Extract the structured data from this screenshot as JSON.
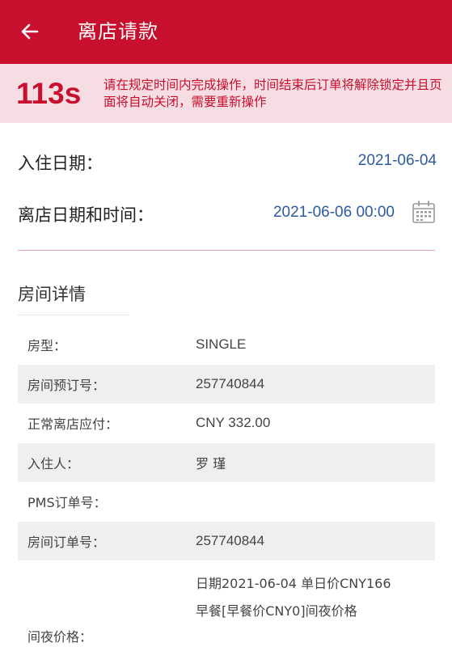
{
  "header": {
    "title": "离店请款",
    "back_icon": "arrow-left-icon",
    "color": "#c8102e"
  },
  "timer": {
    "count": "113s",
    "message": "请在规定时间内完成操作，时间结束后订单将解除锁定并且页面将自动关闭，需要重新操作"
  },
  "checkin": {
    "label": "入住日期：",
    "value": "2021-06-04"
  },
  "checkout": {
    "label": "离店日期和时间：",
    "value": "2021-06-06 00:00",
    "icon": "calendar-icon"
  },
  "room_details": {
    "title": "房间详情",
    "rows": [
      {
        "key": "房型：",
        "value": "SINGLE"
      },
      {
        "key": "房间预订号：",
        "value": "257740844"
      },
      {
        "key": "正常离店应付：",
        "value": "CNY 332.00"
      },
      {
        "key": "入住人：",
        "value": "罗 瑾"
      },
      {
        "key": "PMS订单号：",
        "value": ""
      },
      {
        "key": "房间订单号：",
        "value": "257740844"
      }
    ],
    "night_price": {
      "key": "间夜价格：",
      "line1": "日期2021-06-04 单日价CNY166",
      "line2": "早餐[早餐价CNY0]间夜价格"
    }
  }
}
